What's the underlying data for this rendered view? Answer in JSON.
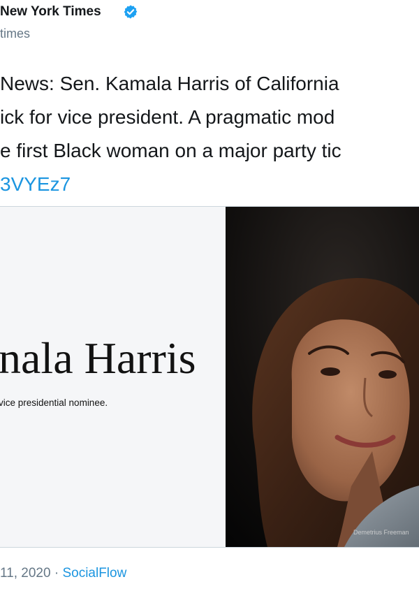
{
  "tweet": {
    "author": {
      "display_name": "New York Times",
      "handle": "times",
      "verified_icon": "verified-badge-icon"
    },
    "text_lines": [
      "News: Sen. Kamala Harris of California",
      "ick for vice president. A pragmatic mod",
      "e first Black woman on a major party tic"
    ],
    "link": "3VYEz7",
    "card": {
      "headline": "nala Harris",
      "subline": "vice presidential nominee.",
      "photo_credit": "Demetrius Freeman"
    },
    "meta": {
      "date": "11, 2020",
      "separator": " · ",
      "source": "SocialFlow"
    }
  },
  "colors": {
    "link": "#1b95e0",
    "secondary_text": "#657786",
    "verified": "#1da1f2",
    "card_background": "#f5f6f8"
  }
}
